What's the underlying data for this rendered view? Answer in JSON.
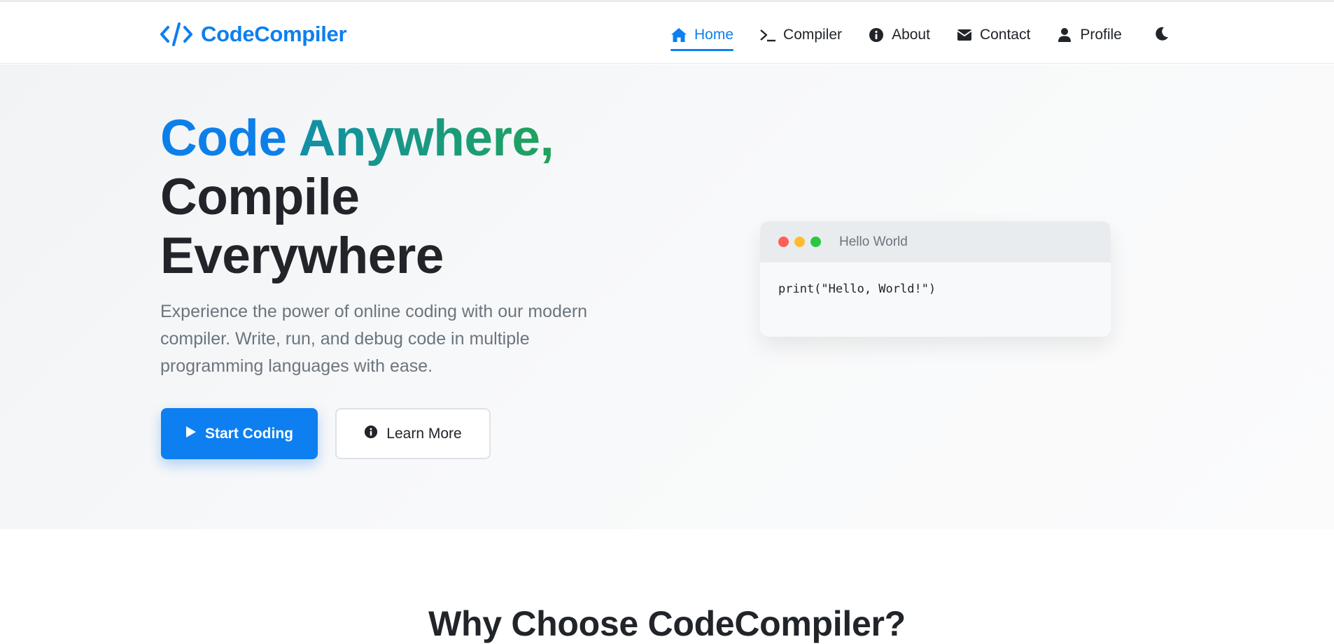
{
  "brand": {
    "name": "CodeCompiler",
    "icon": "code-brackets-icon",
    "color": "#0d7ff0"
  },
  "nav": {
    "items": [
      {
        "label": "Home",
        "icon": "home-icon",
        "active": true
      },
      {
        "label": "Compiler",
        "icon": "terminal-icon",
        "active": false
      },
      {
        "label": "About",
        "icon": "info-circle-icon",
        "active": false
      },
      {
        "label": "Contact",
        "icon": "envelope-icon",
        "active": false
      },
      {
        "label": "Profile",
        "icon": "user-icon",
        "active": false
      }
    ],
    "theme_toggle_icon": "moon-icon"
  },
  "hero": {
    "title_part1": "Code",
    "title_part2": "Anywhere,",
    "title_line2": "Compile",
    "title_line3": "Everywhere",
    "subtitle": "Experience the power of online coding with our modern compiler. Write, run, and debug code in multiple programming languages with ease.",
    "primary_button": {
      "label": "Start Coding",
      "icon": "play-icon"
    },
    "secondary_button": {
      "label": "Learn More",
      "icon": "info-circle-icon"
    }
  },
  "code_window": {
    "title": "Hello World",
    "code": "print(\"Hello, World!\")",
    "dot_colors": [
      "#ff5f57",
      "#febc2e",
      "#28c840"
    ]
  },
  "features": {
    "title": "Why Choose CodeCompiler?"
  },
  "colors": {
    "accent": "#0d7ff0",
    "gradient_end": "#20a35a",
    "text": "#212529",
    "muted": "#6c757d"
  }
}
